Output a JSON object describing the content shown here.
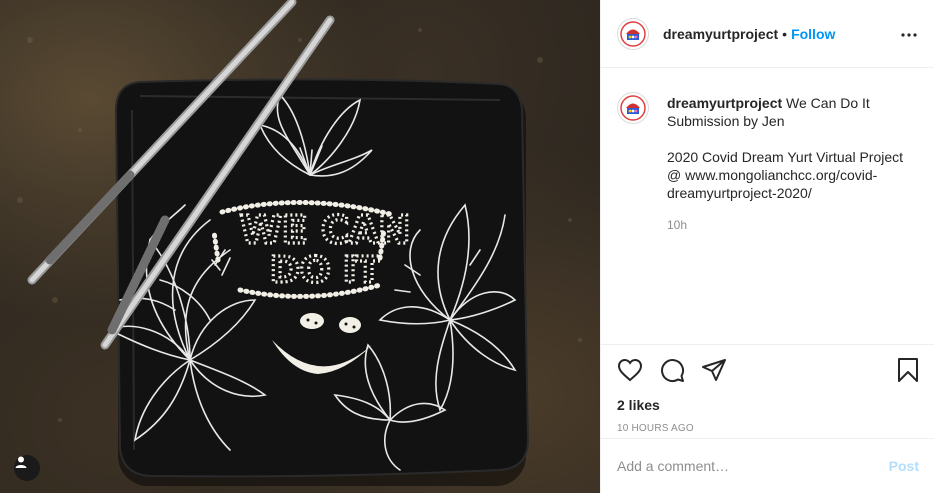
{
  "post": {
    "username": "dreamyurtproject",
    "dot": "•",
    "follow_label": "Follow",
    "more_icon": "more-horizontal-icon",
    "caption": {
      "username": "dreamyurtproject",
      "text": "We Can Do It Submission by Jen\n\n2020 Covid Dream Yurt Virtual Project @ www.mongolianchcc.org/covid-dreamyurtproject-2020/",
      "time": "10h"
    },
    "likes": "2 likes",
    "timestamp": "10 HOURS AGO",
    "comment": {
      "placeholder": "Add a comment…",
      "post_label": "Post"
    }
  },
  "photo": {
    "plate_text_line1": "WE CAN",
    "plate_text_line2": "DO IT",
    "user_tag_icon": "user-icon"
  },
  "colors": {
    "link_blue": "#0095f6",
    "post_disabled": "#b2dffc",
    "muted": "#8e8e8e",
    "plate": "#111111"
  },
  "icons": [
    "heart-icon",
    "comment-icon",
    "share-icon",
    "bookmark-icon"
  ]
}
